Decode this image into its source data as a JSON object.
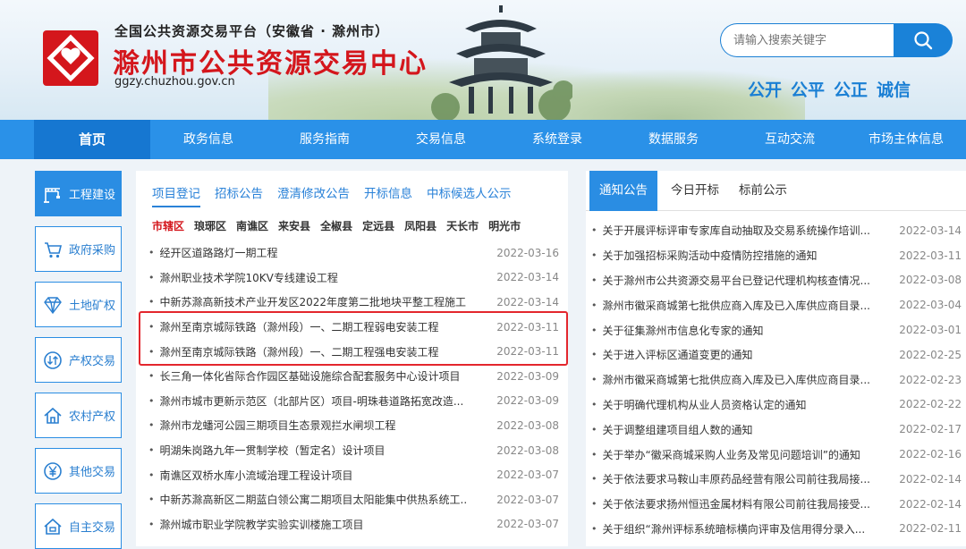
{
  "header": {
    "slogan": "全国公共资源交易平台（安徽省 · 滁州市）",
    "title": "滁州市公共资源交易中心",
    "url": "ggzy.chuzhou.gov.cn",
    "search_placeholder": "请输入搜索关键字",
    "motto": [
      "公开",
      "公平",
      "公正",
      "诚信"
    ]
  },
  "nav": [
    "首页",
    "政务信息",
    "服务指南",
    "交易信息",
    "系统登录",
    "数据服务",
    "互动交流",
    "市场主体信息"
  ],
  "sidebar": [
    {
      "label": "工程建设",
      "icon": "crane-icon"
    },
    {
      "label": "政府采购",
      "icon": "cart-icon"
    },
    {
      "label": "土地矿权",
      "icon": "diamond-icon"
    },
    {
      "label": "产权交易",
      "icon": "exchange-icon"
    },
    {
      "label": "农村产权",
      "icon": "house-icon"
    },
    {
      "label": "其他交易",
      "icon": "yen-icon"
    },
    {
      "label": "自主交易",
      "icon": "home-icon"
    }
  ],
  "middle": {
    "tabs": [
      "项目登记",
      "招标公告",
      "澄清修改公告",
      "开标信息",
      "中标候选人公示"
    ],
    "districts": [
      "市辖区",
      "琅琊区",
      "南谯区",
      "来安县",
      "全椒县",
      "定远县",
      "凤阳县",
      "天长市",
      "明光市"
    ],
    "items": [
      {
        "title": "经开区道路路灯一期工程",
        "date": "2022-03-16"
      },
      {
        "title": "滁州职业技术学院10KV专线建设工程",
        "date": "2022-03-14"
      },
      {
        "title": "中新苏滁高新技术产业开发区2022年度第二批地块平整工程施工",
        "date": "2022-03-14"
      },
      {
        "title": "滁州至南京城际铁路（滁州段）一、二期工程弱电安装工程",
        "date": "2022-03-11"
      },
      {
        "title": "滁州至南京城际铁路（滁州段）一、二期工程强电安装工程",
        "date": "2022-03-11"
      },
      {
        "title": "长三角一体化省际合作园区基础设施综合配套服务中心设计项目",
        "date": "2022-03-09"
      },
      {
        "title": "滁州市城市更新示范区（北部片区）项目-明珠巷道路拓宽改造...",
        "date": "2022-03-09"
      },
      {
        "title": "滁州市龙蟠河公园三期项目生态景观拦水闸坝工程",
        "date": "2022-03-08"
      },
      {
        "title": "明湖朱岗路九年一贯制学校（暂定名）设计项目",
        "date": "2022-03-08"
      },
      {
        "title": "南谯区双桥水库小流域治理工程设计项目",
        "date": "2022-03-07"
      },
      {
        "title": "中新苏滁高新区二期蓝白领公寓二期项目太阳能集中供热系统工...",
        "date": "2022-03-07"
      },
      {
        "title": "滁州城市职业学院教学实验实训楼施工项目",
        "date": "2022-03-07"
      }
    ]
  },
  "right": {
    "tabs": [
      "通知公告",
      "今日开标",
      "标前公示"
    ],
    "items": [
      {
        "title": "关于开展评标评审专家库自动抽取及交易系统操作培训...",
        "date": "2022-03-14"
      },
      {
        "title": "关于加强招标采购活动中疫情防控措施的通知",
        "date": "2022-03-11"
      },
      {
        "title": "关于滁州市公共资源交易平台已登记代理机构核查情况...",
        "date": "2022-03-08"
      },
      {
        "title": "滁州市徽采商城第七批供应商入库及已入库供应商目录...",
        "date": "2022-03-04"
      },
      {
        "title": "关于征集滁州市信息化专家的通知",
        "date": "2022-03-01"
      },
      {
        "title": "关于进入评标区通道变更的通知",
        "date": "2022-02-25"
      },
      {
        "title": "滁州市徽采商城第七批供应商入库及已入库供应商目录...",
        "date": "2022-02-23"
      },
      {
        "title": "关于明确代理机构从业人员资格认定的通知",
        "date": "2022-02-22"
      },
      {
        "title": "关于调整组建项目组人数的通知",
        "date": "2022-02-17"
      },
      {
        "title": "关于举办“徽采商城采购人业务及常见问题培训”的通知",
        "date": "2022-02-16"
      },
      {
        "title": "关于依法要求马鞍山丰原药品经营有限公司前往我局接...",
        "date": "2022-02-14"
      },
      {
        "title": "关于依法要求扬州恒迅金属材料有限公司前往我局接受...",
        "date": "2022-02-14"
      },
      {
        "title": "关于组织“滁州评标系统暗标横向评审及信用得分录入...",
        "date": "2022-02-11"
      }
    ]
  },
  "colors": {
    "brand_red": "#d4161c",
    "primary_blue": "#2a91e8",
    "highlight": "#e3262d"
  }
}
